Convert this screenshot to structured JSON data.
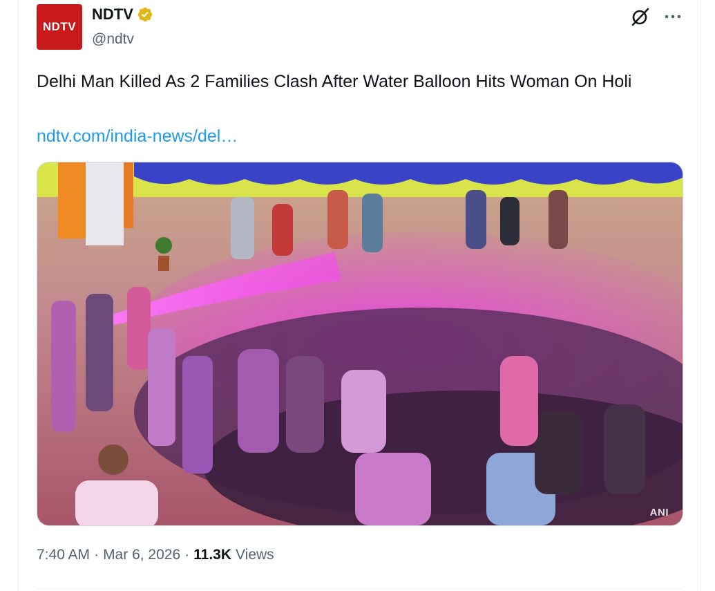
{
  "author": {
    "avatar_text": "NDTV",
    "display_name": "NDTV",
    "handle": "@ndtv",
    "verified_color": "#e2b719",
    "brand_color": "#c81a1a"
  },
  "actions": {
    "grok_icon": "grok-icon",
    "more_icon": "more-icon"
  },
  "tweet": {
    "text": "Delhi Man Killed As 2 Families Clash After Water Balloon Hits Woman On Holi",
    "link": "ndtv.com/india-news/del…",
    "link_color": "#1d9bf0"
  },
  "media": {
    "watermark": "ANI"
  },
  "meta": {
    "time": "7:40 AM",
    "separator": "·",
    "date": "Mar 6, 2026",
    "views_count": "11.3K",
    "views_label": "Views"
  }
}
